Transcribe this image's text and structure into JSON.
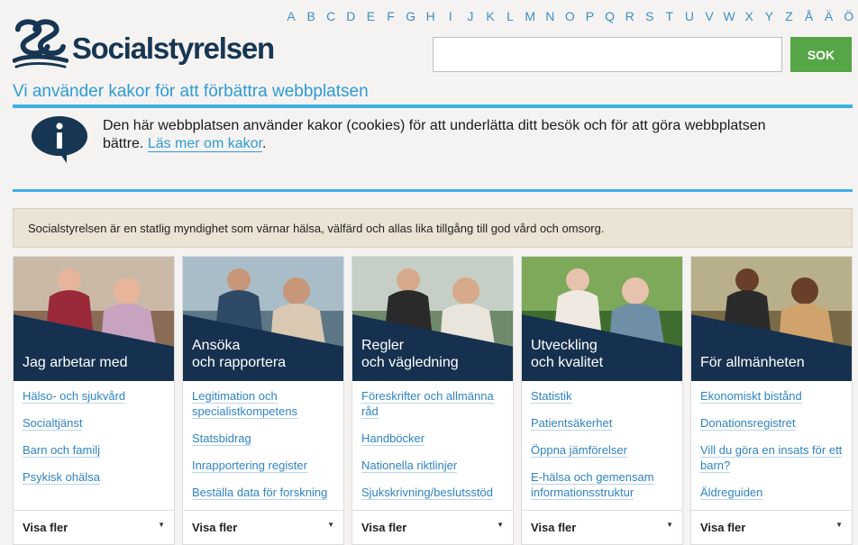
{
  "header": {
    "logo_text": "Socialstyrelsen",
    "alphabet": [
      "A",
      "B",
      "C",
      "D",
      "E",
      "F",
      "G",
      "H",
      "I",
      "J",
      "K",
      "L",
      "M",
      "N",
      "O",
      "P",
      "Q",
      "R",
      "S",
      "T",
      "U",
      "V",
      "W",
      "X",
      "Y",
      "Z",
      "Å",
      "Ä",
      "Ö"
    ],
    "search_placeholder": "",
    "search_button": "SOK"
  },
  "cookie": {
    "title": "Vi använder kakor för att förbättra webbplatsen",
    "text": "Den här webbplatsen använder kakor (cookies) för att underlätta ditt besök och för att göra webbplatsen bättre.",
    "link": "Läs mer om kakor",
    "icon": "info-bubble-icon"
  },
  "mission": "Socialstyrelsen är en statlig myndighet som värnar hälsa, välfärd och allas lika tillgång till god vård och omsorg.",
  "cards": [
    {
      "title_lines": [
        "Jag arbetar med",
        ""
      ],
      "links": [
        "Hälso- och sjukvård",
        "Socialtjänst",
        "Barn och familj",
        "Psykisk ohälsa"
      ],
      "more": "Visa fler",
      "colors": {
        "sky": "#c9b9a6",
        "bg": "#8a6b56",
        "skin": "#e6b59a",
        "shirt": "#9a2a3a",
        "shirt2": "#c7a3c0"
      }
    },
    {
      "title_lines": [
        "Ansöka",
        "och rapportera"
      ],
      "links": [
        "Legitimation och specialistkompetens",
        "Statsbidrag",
        "Inrapportering register",
        "Beställa data för forskning"
      ],
      "more": "Visa fler",
      "colors": {
        "sky": "#a9bdc8",
        "bg": "#5d7786",
        "skin": "#c89678",
        "shirt": "#2f4a66",
        "shirt2": "#d9c8b2"
      }
    },
    {
      "title_lines": [
        "Regler",
        "och vägledning"
      ],
      "links": [
        "Föreskrifter och allmänna råd",
        "Handböcker",
        "Nationella riktlinjer",
        "Sjukskrivning/beslutsstöd"
      ],
      "more": "Visa fler",
      "colors": {
        "sky": "#c6cfc5",
        "bg": "#6f8a6a",
        "skin": "#d6a98a",
        "shirt": "#2a2a2a",
        "shirt2": "#e9e4dc"
      }
    },
    {
      "title_lines": [
        "Utveckling",
        "och kvalitet"
      ],
      "links": [
        "Statistik",
        "Patientsäkerhet",
        "Öppna jämförelser",
        "E-hälsa och gemensam informationsstruktur"
      ],
      "more": "Visa fler",
      "colors": {
        "sky": "#7ea85a",
        "bg": "#3f6d2f",
        "skin": "#e7c2ad",
        "shirt": "#efe9e2",
        "shirt2": "#6f8fa7"
      }
    },
    {
      "title_lines": [
        "För allmänheten",
        ""
      ],
      "links": [
        "Ekonomiskt bistånd",
        "Donationsregistret",
        "Vill du göra en insats för ett barn?",
        "Äldreguiden"
      ],
      "more": "Visa fler",
      "colors": {
        "sky": "#b8b08a",
        "bg": "#7a6a48",
        "skin": "#6a3f2a",
        "shirt": "#2b2b2b",
        "shirt2": "#cfa36b"
      }
    }
  ]
}
